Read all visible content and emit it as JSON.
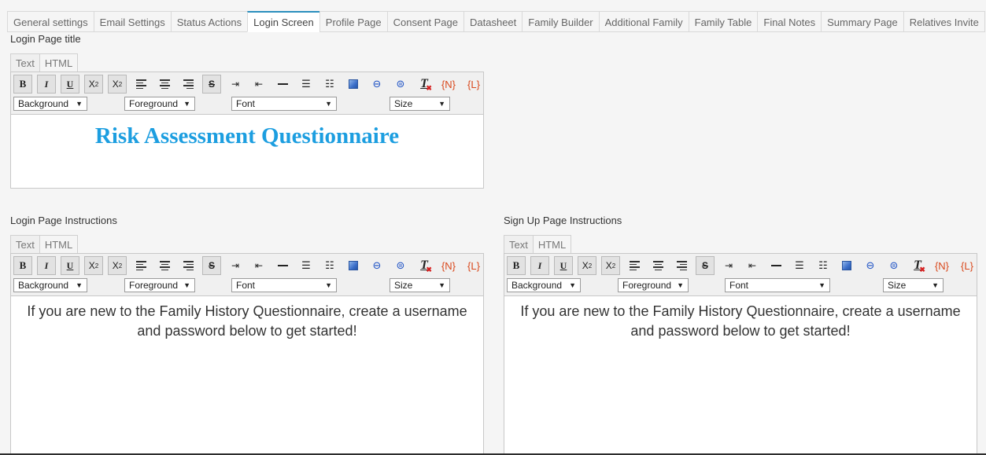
{
  "tabs": [
    {
      "label": "General settings",
      "active": false
    },
    {
      "label": "Email Settings",
      "active": false
    },
    {
      "label": "Status Actions",
      "active": false
    },
    {
      "label": "Login Screen",
      "active": true
    },
    {
      "label": "Profile Page",
      "active": false
    },
    {
      "label": "Consent Page",
      "active": false
    },
    {
      "label": "Datasheet",
      "active": false
    },
    {
      "label": "Family Builder",
      "active": false
    },
    {
      "label": "Additional Family",
      "active": false
    },
    {
      "label": "Family Table",
      "active": false
    },
    {
      "label": "Final Notes",
      "active": false
    },
    {
      "label": "Summary Page",
      "active": false
    },
    {
      "label": "Relatives Invite",
      "active": false
    }
  ],
  "editor_common": {
    "mode_text": "Text",
    "mode_html": "HTML",
    "background_label": "Background",
    "foreground_label": "Foreground",
    "font_label": "Font",
    "size_label": "Size",
    "bold": "B",
    "italic": "I",
    "underline": "U",
    "strike": "S",
    "name_token": "{N}",
    "link_token": "{L}"
  },
  "title_editor": {
    "label": "Login Page title",
    "content": "Risk Assessment Questionnaire"
  },
  "login_instructions": {
    "label": "Login Page Instructions",
    "content": "If you are new to the Family History Questionnaire, create a username and password below to get started!"
  },
  "signup_instructions": {
    "label": "Sign Up Page Instructions",
    "content": "If you are new to the Family History Questionnaire, create a username and password below to get started!"
  },
  "colors": {
    "accent": "#2a8fbd",
    "title_text": "#1c9ee0",
    "token_red": "#d9481c"
  }
}
